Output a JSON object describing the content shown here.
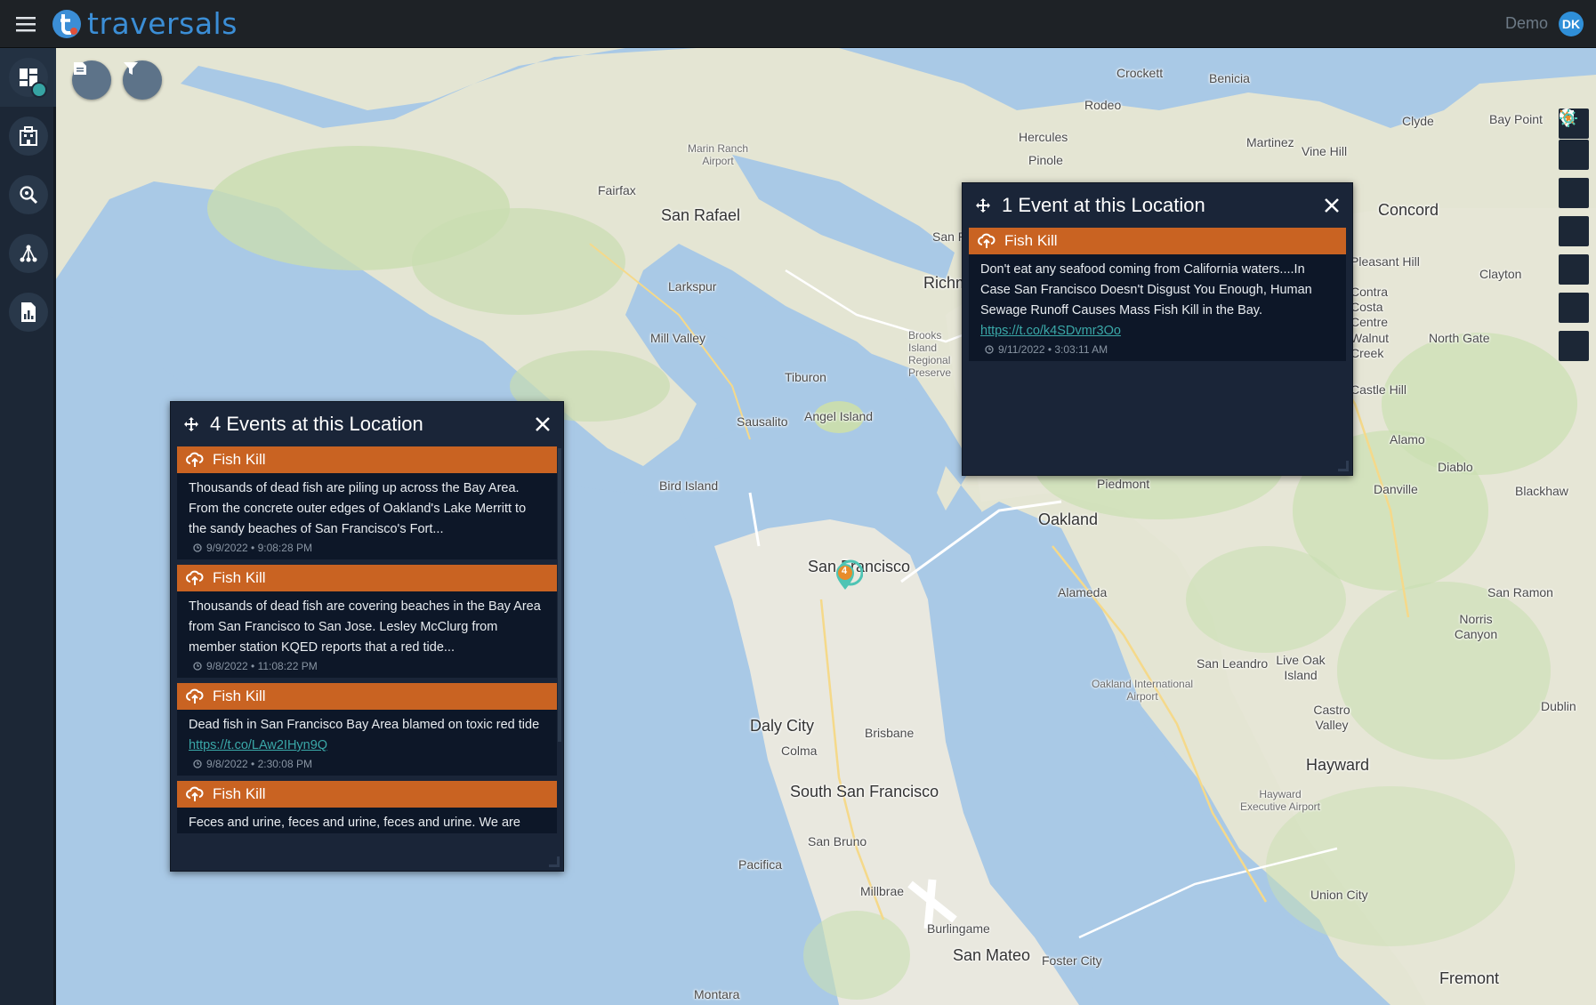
{
  "app": {
    "name": "traversals",
    "user_label": "Demo",
    "user_initials": "DK"
  },
  "sidebar": {
    "items": [
      {
        "icon": "dashboard-icon",
        "active": true
      },
      {
        "icon": "building-icon",
        "active": false
      },
      {
        "icon": "search-icon",
        "active": false
      },
      {
        "icon": "network-icon",
        "active": false
      },
      {
        "icon": "report-icon",
        "active": false
      }
    ]
  },
  "map": {
    "labels": [
      {
        "t": "Crockett"
      },
      {
        "t": "Benicia"
      },
      {
        "t": "Rodeo"
      },
      {
        "t": "Hercules"
      },
      {
        "t": "Martinez"
      },
      {
        "t": "Vine Hill"
      },
      {
        "t": "Clyde"
      },
      {
        "t": "Bay Point"
      },
      {
        "t": "Pinole"
      },
      {
        "t": "Concord"
      },
      {
        "t": "San Rafael"
      },
      {
        "t": "Fairfax"
      },
      {
        "t": "Marin Ranch Airport"
      },
      {
        "t": "Larkspur"
      },
      {
        "t": "Mill Valley"
      },
      {
        "t": "Tiburon"
      },
      {
        "t": "Sausalito"
      },
      {
        "t": "Angel Island"
      },
      {
        "t": "Bird Island"
      },
      {
        "t": "Piedmont"
      },
      {
        "t": "Oakland"
      },
      {
        "t": "Alameda"
      },
      {
        "t": "San Francisco"
      },
      {
        "t": "Danville"
      },
      {
        "t": "Diablo"
      },
      {
        "t": "Alamo"
      },
      {
        "t": "Blackhaw"
      },
      {
        "t": "North Gate"
      },
      {
        "t": "Walnut Creek"
      },
      {
        "t": "Castle Hill"
      },
      {
        "t": "Contra Costa Centre"
      },
      {
        "t": "Pleasant Hill"
      },
      {
        "t": "Clayton"
      },
      {
        "t": "San Ramon"
      },
      {
        "t": "Norris Canyon"
      },
      {
        "t": "San Leandro"
      },
      {
        "t": "Live Oak Island"
      },
      {
        "t": "Oakland International Airport"
      },
      {
        "t": "Castro Valley"
      },
      {
        "t": "Dublin"
      },
      {
        "t": "Hayward"
      },
      {
        "t": "Hayward Executive Airport"
      },
      {
        "t": "Daly City"
      },
      {
        "t": "Colma"
      },
      {
        "t": "Brisbane"
      },
      {
        "t": "South San Francisco"
      },
      {
        "t": "San Bruno"
      },
      {
        "t": "Pacifica"
      },
      {
        "t": "Millbrae"
      },
      {
        "t": "Burlingame"
      },
      {
        "t": "San Mateo"
      },
      {
        "t": "Foster City"
      },
      {
        "t": "Union City"
      },
      {
        "t": "Fremont"
      },
      {
        "t": "Montara"
      },
      {
        "t": "Brooks Island Regional Preserve"
      },
      {
        "t": "Richmond"
      },
      {
        "t": "San Pablo"
      }
    ],
    "cluster_count": "4",
    "controls": [
      "zoom-in-icon",
      "zoom-out-icon",
      "moon-icon",
      "location-pin-icon",
      "refresh-icon",
      "lightning-off-icon",
      "sun-icon"
    ]
  },
  "panel_left": {
    "title": "4 Events at this Location",
    "events": [
      {
        "category": "Fish Kill",
        "text": "Thousands of dead fish are piling up across the Bay Area. From the concrete outer edges of Oakland's Lake Merritt to the sandy beaches of San Francisco's Fort...",
        "link": "",
        "time": "9/9/2022 • 9:08:28 PM"
      },
      {
        "category": "Fish Kill",
        "text": "Thousands of dead fish are covering beaches in the Bay Area from San Francisco to San Jose. Lesley McClurg from member station KQED reports that a red tide...",
        "link": "",
        "time": "9/8/2022 • 11:08:22 PM"
      },
      {
        "category": "Fish Kill",
        "text": "Dead fish in San Francisco Bay Area blamed on toxic red tide",
        "link": "https://t.co/LAw2IHyn9Q",
        "time": "9/8/2022 • 2:30:08 PM"
      },
      {
        "category": "Fish Kill",
        "text": "Feces and urine, feces and urine, feces and urine. We are",
        "link": "",
        "time": ""
      }
    ]
  },
  "panel_right": {
    "title": "1 Event at this Location",
    "events": [
      {
        "category": "Fish Kill",
        "text": "Don't eat any seafood coming from California waters....In Case San Francisco Doesn't Disgust You Enough, Human Sewage Runoff Causes Mass Fish Kill in the Bay.",
        "link": "https://t.co/k4SDvmr3Oo",
        "time": "9/11/2022 • 3:03:11 AM"
      }
    ]
  },
  "colors": {
    "accent": "#3b8ed6",
    "event_header": "#c96322",
    "panel_bg": "#1a2538",
    "link": "#3aa8a8"
  }
}
